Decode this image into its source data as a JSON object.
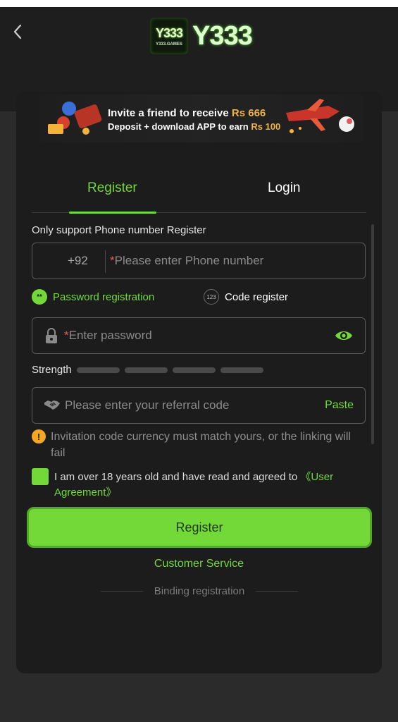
{
  "brand": {
    "badge_text": "Y333",
    "badge_sub": "Y333.GAMES",
    "logo_text": "Y333"
  },
  "banner": {
    "line1_text": "Invite a friend to receive",
    "line1_amount": "Rs 666",
    "line2_text": "Deposit + download APP to earn",
    "line2_amount": "Rs 100"
  },
  "tabs": {
    "register": "Register",
    "login": "Login",
    "active": "register"
  },
  "form": {
    "support_label": "Only support Phone number Register",
    "country_code": "+92",
    "required_mark": "*",
    "phone_placeholder": "Please enter Phone number",
    "mode_password": "Password registration",
    "mode_password_icon_text": "**",
    "mode_code": "Code register",
    "mode_code_icon_text": "123",
    "password_placeholder": "Enter password",
    "strength_label": "Strength",
    "strength_level": 0,
    "strength_segments": 4,
    "referral_placeholder": "Please enter your referral code",
    "paste_label": "Paste",
    "warning_icon_text": "!",
    "warning_text": "Invitation code currency must match yours, or the linking will fail",
    "agree_checked": true,
    "agree_text": "I am over 18 years old and have read and agreed to",
    "agree_link": "《User Agreement》",
    "register_button": "Register",
    "customer_service": "Customer Service",
    "binding_registration": "Binding registration"
  },
  "colors": {
    "accent": "#73d939",
    "background": "#2b2b2b",
    "card": "#1c1c1c",
    "gold": "#f2b33c",
    "warning": "#f5a623",
    "required": "#e35a5a"
  },
  "icons": {
    "back": "chevron-left-icon",
    "lock": "lock-icon",
    "eye": "eye-icon",
    "handshake": "handshake-icon",
    "warning": "warning-icon"
  }
}
